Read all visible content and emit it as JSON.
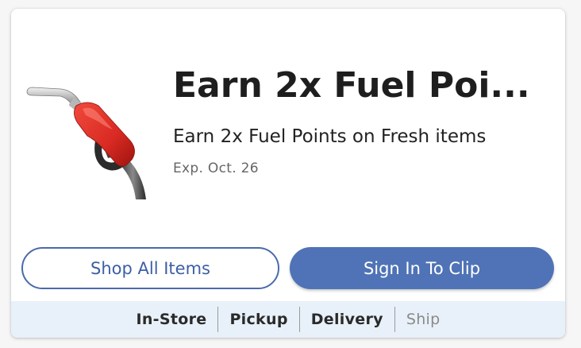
{
  "coupon": {
    "image_icon": "fuel-pump-nozzle-icon",
    "title": "Earn 2x Fuel Poi...",
    "description": "Earn 2x Fuel Points on Fresh items",
    "expiry": "Exp. Oct. 26"
  },
  "actions": {
    "shop_all_label": "Shop All Items",
    "sign_in_label": "Sign In To Clip"
  },
  "modalities": [
    {
      "label": "In-Store",
      "available": true
    },
    {
      "label": "Pickup",
      "available": true
    },
    {
      "label": "Delivery",
      "available": true
    },
    {
      "label": "Ship",
      "available": false
    }
  ],
  "colors": {
    "primary": "#4f73b6",
    "outline": "#4a6aaa",
    "modality_bar_bg": "#e8f1f9",
    "nozzle_red": "#d92a23"
  }
}
